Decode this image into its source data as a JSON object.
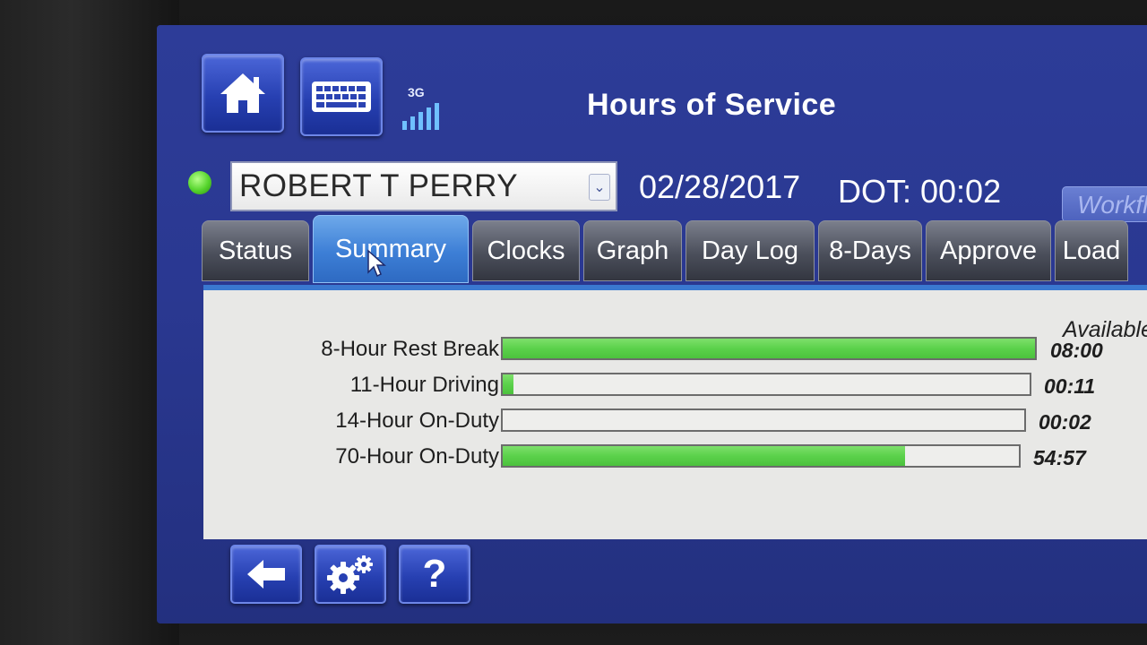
{
  "header": {
    "network": "3G",
    "title": "Hours of Service",
    "home_icon": "home-icon",
    "keyboard_icon": "keyboard-icon"
  },
  "driver": {
    "name": "ROBERT T PERRY",
    "status_color": "#55d42c"
  },
  "info": {
    "date": "02/28/2017",
    "dot": "DOT: 00:02",
    "workflow_label": "Workflo"
  },
  "tabs": [
    {
      "label": "Status",
      "active": false
    },
    {
      "label": "Summary",
      "active": true
    },
    {
      "label": "Clocks",
      "active": false
    },
    {
      "label": "Graph",
      "active": false
    },
    {
      "label": "Day Log",
      "active": false
    },
    {
      "label": "8-Days",
      "active": false
    },
    {
      "label": "Approve",
      "active": false
    },
    {
      "label": "Load",
      "active": false
    }
  ],
  "summary": {
    "available_header": "Available",
    "rows": [
      {
        "label": "8-Hour Rest Break",
        "value": "08:00",
        "fill_fraction": 1.0
      },
      {
        "label": "11-Hour Driving",
        "value": "00:11",
        "fill_fraction": 0.02
      },
      {
        "label": "14-Hour On-Duty",
        "value": "00:02",
        "fill_fraction": 0.0
      },
      {
        "label": "70-Hour On-Duty",
        "value": "54:57",
        "fill_fraction": 0.78
      }
    ]
  },
  "footer": {
    "back_icon": "back-arrow-icon",
    "settings_icon": "gear-icon",
    "help_label": "?"
  },
  "colors": {
    "screen_bg": "#2d3c98",
    "bar_fill": "#5bd14b",
    "active_tab": "#3d7fd6"
  }
}
